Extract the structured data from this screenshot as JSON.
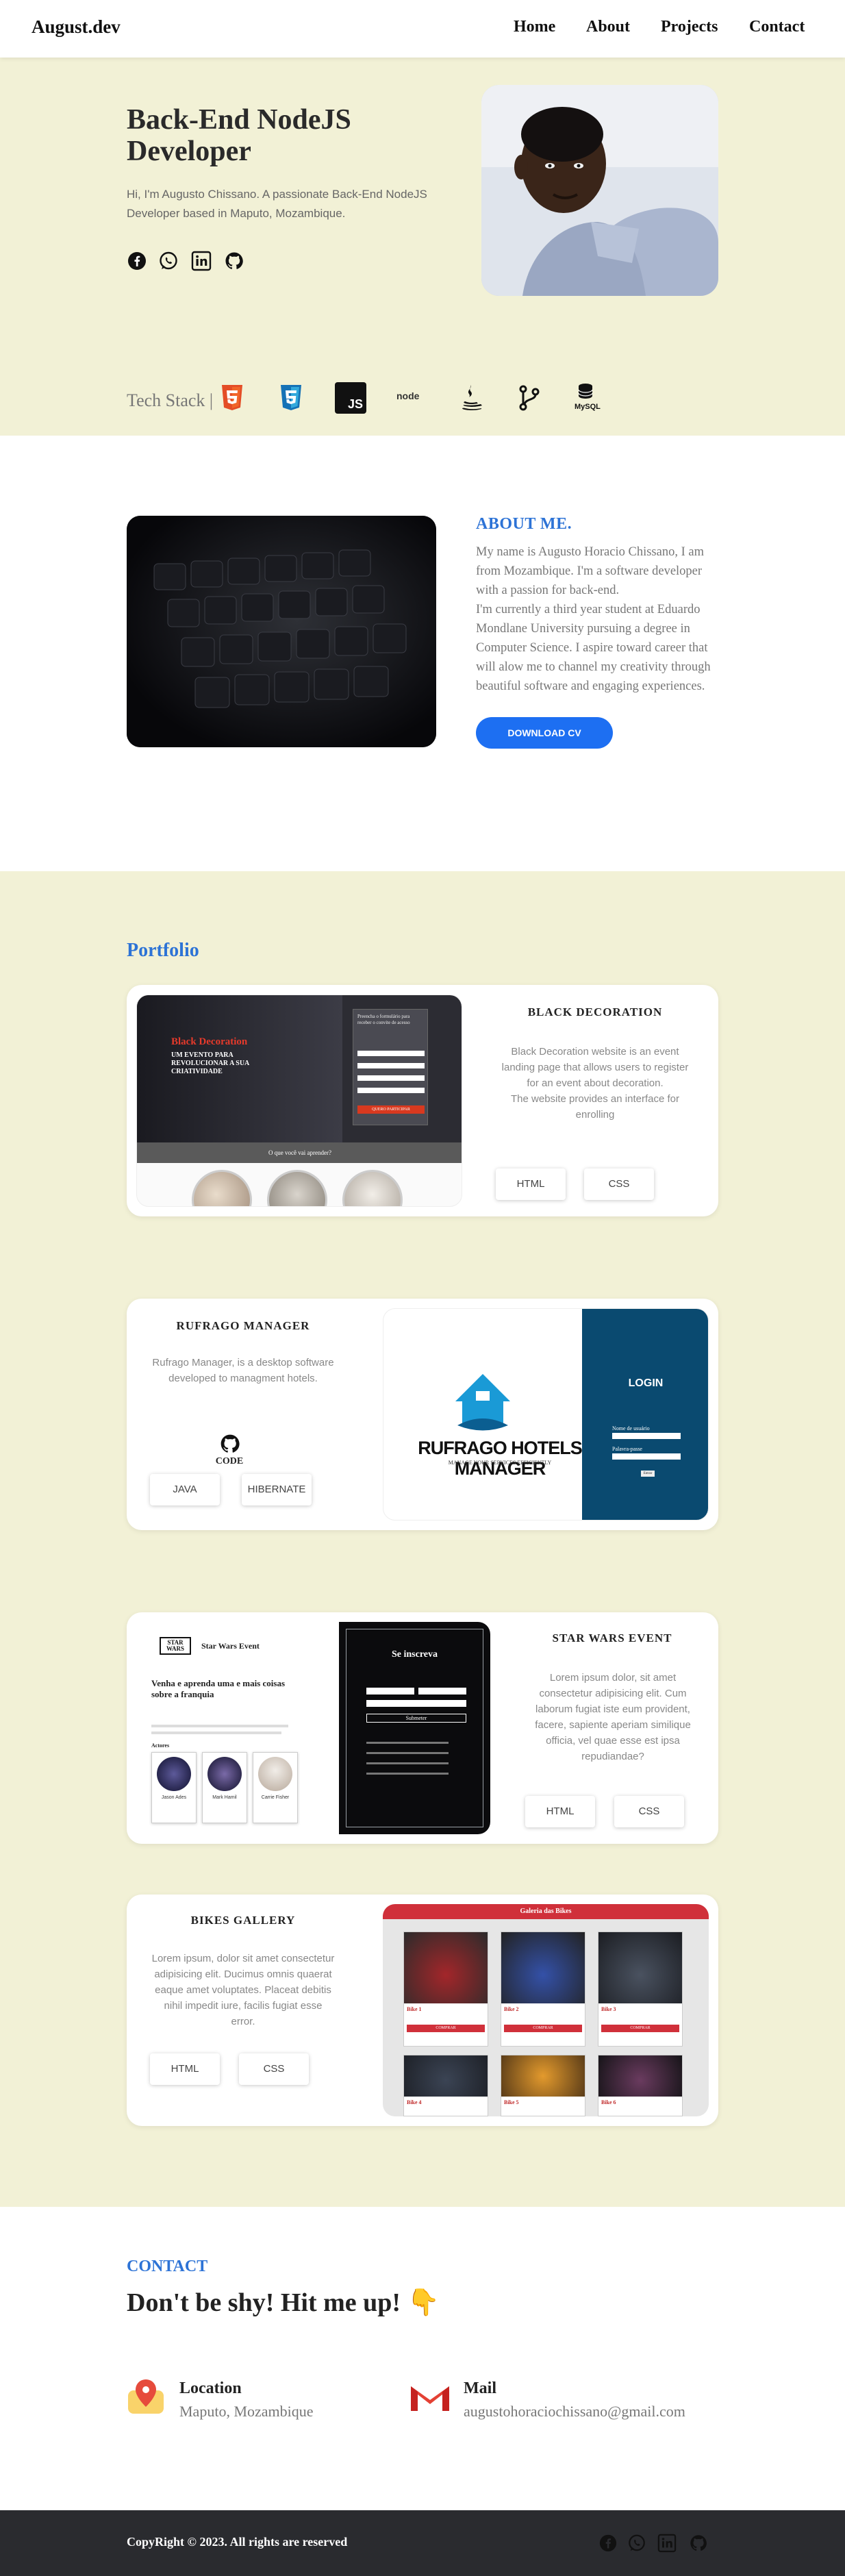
{
  "header": {
    "logo": "August.dev",
    "nav": [
      "Home",
      "About",
      "Projects",
      "Contact"
    ]
  },
  "hero": {
    "title": "Back-End NodeJS Developer",
    "description": "Hi, I'm Augusto Chissano. A passionate Back-End NodeJS Developer based in Maputo, Mozambique.",
    "social_icons": [
      "facebook-icon",
      "whatsapp-icon",
      "linkedin-icon",
      "github-icon"
    ],
    "tech_stack_label": "Tech Stack |",
    "tech_icons": [
      "html5-icon",
      "css3-icon",
      "javascript-icon",
      "nodejs-icon",
      "java-icon",
      "git-icon",
      "mysql-icon"
    ],
    "tech_texts": {
      "js": "JS",
      "node": "node",
      "mysql": "MySQL"
    }
  },
  "about": {
    "title": "ABOUT ME.",
    "text": "My name is Augusto Horacio Chissano, I am from Mozambique. I'm a software developer with a passion for back-end.\nI'm currently a third year student at Eduardo Mondlane University pursuing a degree in Computer Science. I aspire toward career that will alow me to channel my creativity through beautiful software and engaging experiences.",
    "button": "DOWNLOAD CV"
  },
  "portfolio": {
    "title": "Portfolio",
    "projects": [
      {
        "title": "BLACK DECORATION",
        "description": "Black Decoration website is an event landing page that allows users to register for an event about decoration.\nThe website provides an interface for enrolling",
        "tags": [
          "HTML",
          "CSS"
        ],
        "screenshot": {
          "brand": "Black Decoration",
          "headline": "UM EVENTO PARA REVOLUCIONAR A SUA CRIATIVIDADE",
          "form_title": "Preencha o formulário para receber o convite de acesso",
          "submit": "QUERO PARTICIPAR",
          "strip": "O que você vai aprender?"
        }
      },
      {
        "title": "RUFRAGO MANAGER",
        "description": "Rufrago Manager, is a desktop software developed to managment hotels.",
        "code_label": "CODE",
        "tags": [
          "JAVA",
          "HIBERNATE"
        ],
        "screenshot": {
          "brand": "RUFRAGO HOTELS MANAGER",
          "subtitle": "MANAGE YOUR SERVICES EFFICIENTLY",
          "login_title": "LOGIN",
          "username_label": "Nome de usuário",
          "password_label": "Palavra-passe",
          "enter": "Entrar"
        }
      },
      {
        "title": "STAR WARS EVENT",
        "description": "Lorem ipsum dolor, sit amet consectetur adipisicing elit. Cum laborum fugiat iste eum provident, facere, sapiente aperiam similique officia, vel quae esse est ipsa repudiandae?",
        "tags": [
          "HTML",
          "CSS"
        ],
        "screenshot": {
          "logo": "STAR WARS",
          "brand": "Star Wars Event",
          "headline": "Venha e aprenda uma e mais coisas sobre a franquia",
          "actors_label": "Actores",
          "actors": [
            "Jason Ades",
            "Mark Hamil",
            "Carrie Fisher"
          ],
          "signup_title": "Se inscreva",
          "signup_button": "Submeter"
        }
      },
      {
        "title": "BIKES GALLERY",
        "description": "Lorem ipsum, dolor sit amet consectetur adipisicing elit. Ducimus omnis quaerat eaque amet voluptates. Placeat debitis nihil impedit iure, facilis fugiat esse error.",
        "tags": [
          "HTML",
          "CSS"
        ],
        "screenshot": {
          "header": "Galeria das Bikes",
          "bikes": [
            "Bike 1",
            "Bike 2",
            "Bike 3",
            "Bike 4",
            "Bike 5",
            "Bike 6"
          ],
          "buy": "COMPRAR"
        }
      }
    ]
  },
  "contact": {
    "label": "CONTACT",
    "heading": "Don't be shy! Hit me up! 👇",
    "location_title": "Location",
    "location_value": "Maputo, Mozambique",
    "mail_title": "Mail",
    "mail_value": "augustohoraciochissano@gmail.com"
  },
  "footer": {
    "copyright": "CopyRight © 2023. All rights are reserved"
  },
  "colors": {
    "accent": "#2d73d6",
    "hero_bg": "#f2f1d6",
    "button": "#1d6ff2",
    "footer_bg": "#2a2b2f"
  }
}
